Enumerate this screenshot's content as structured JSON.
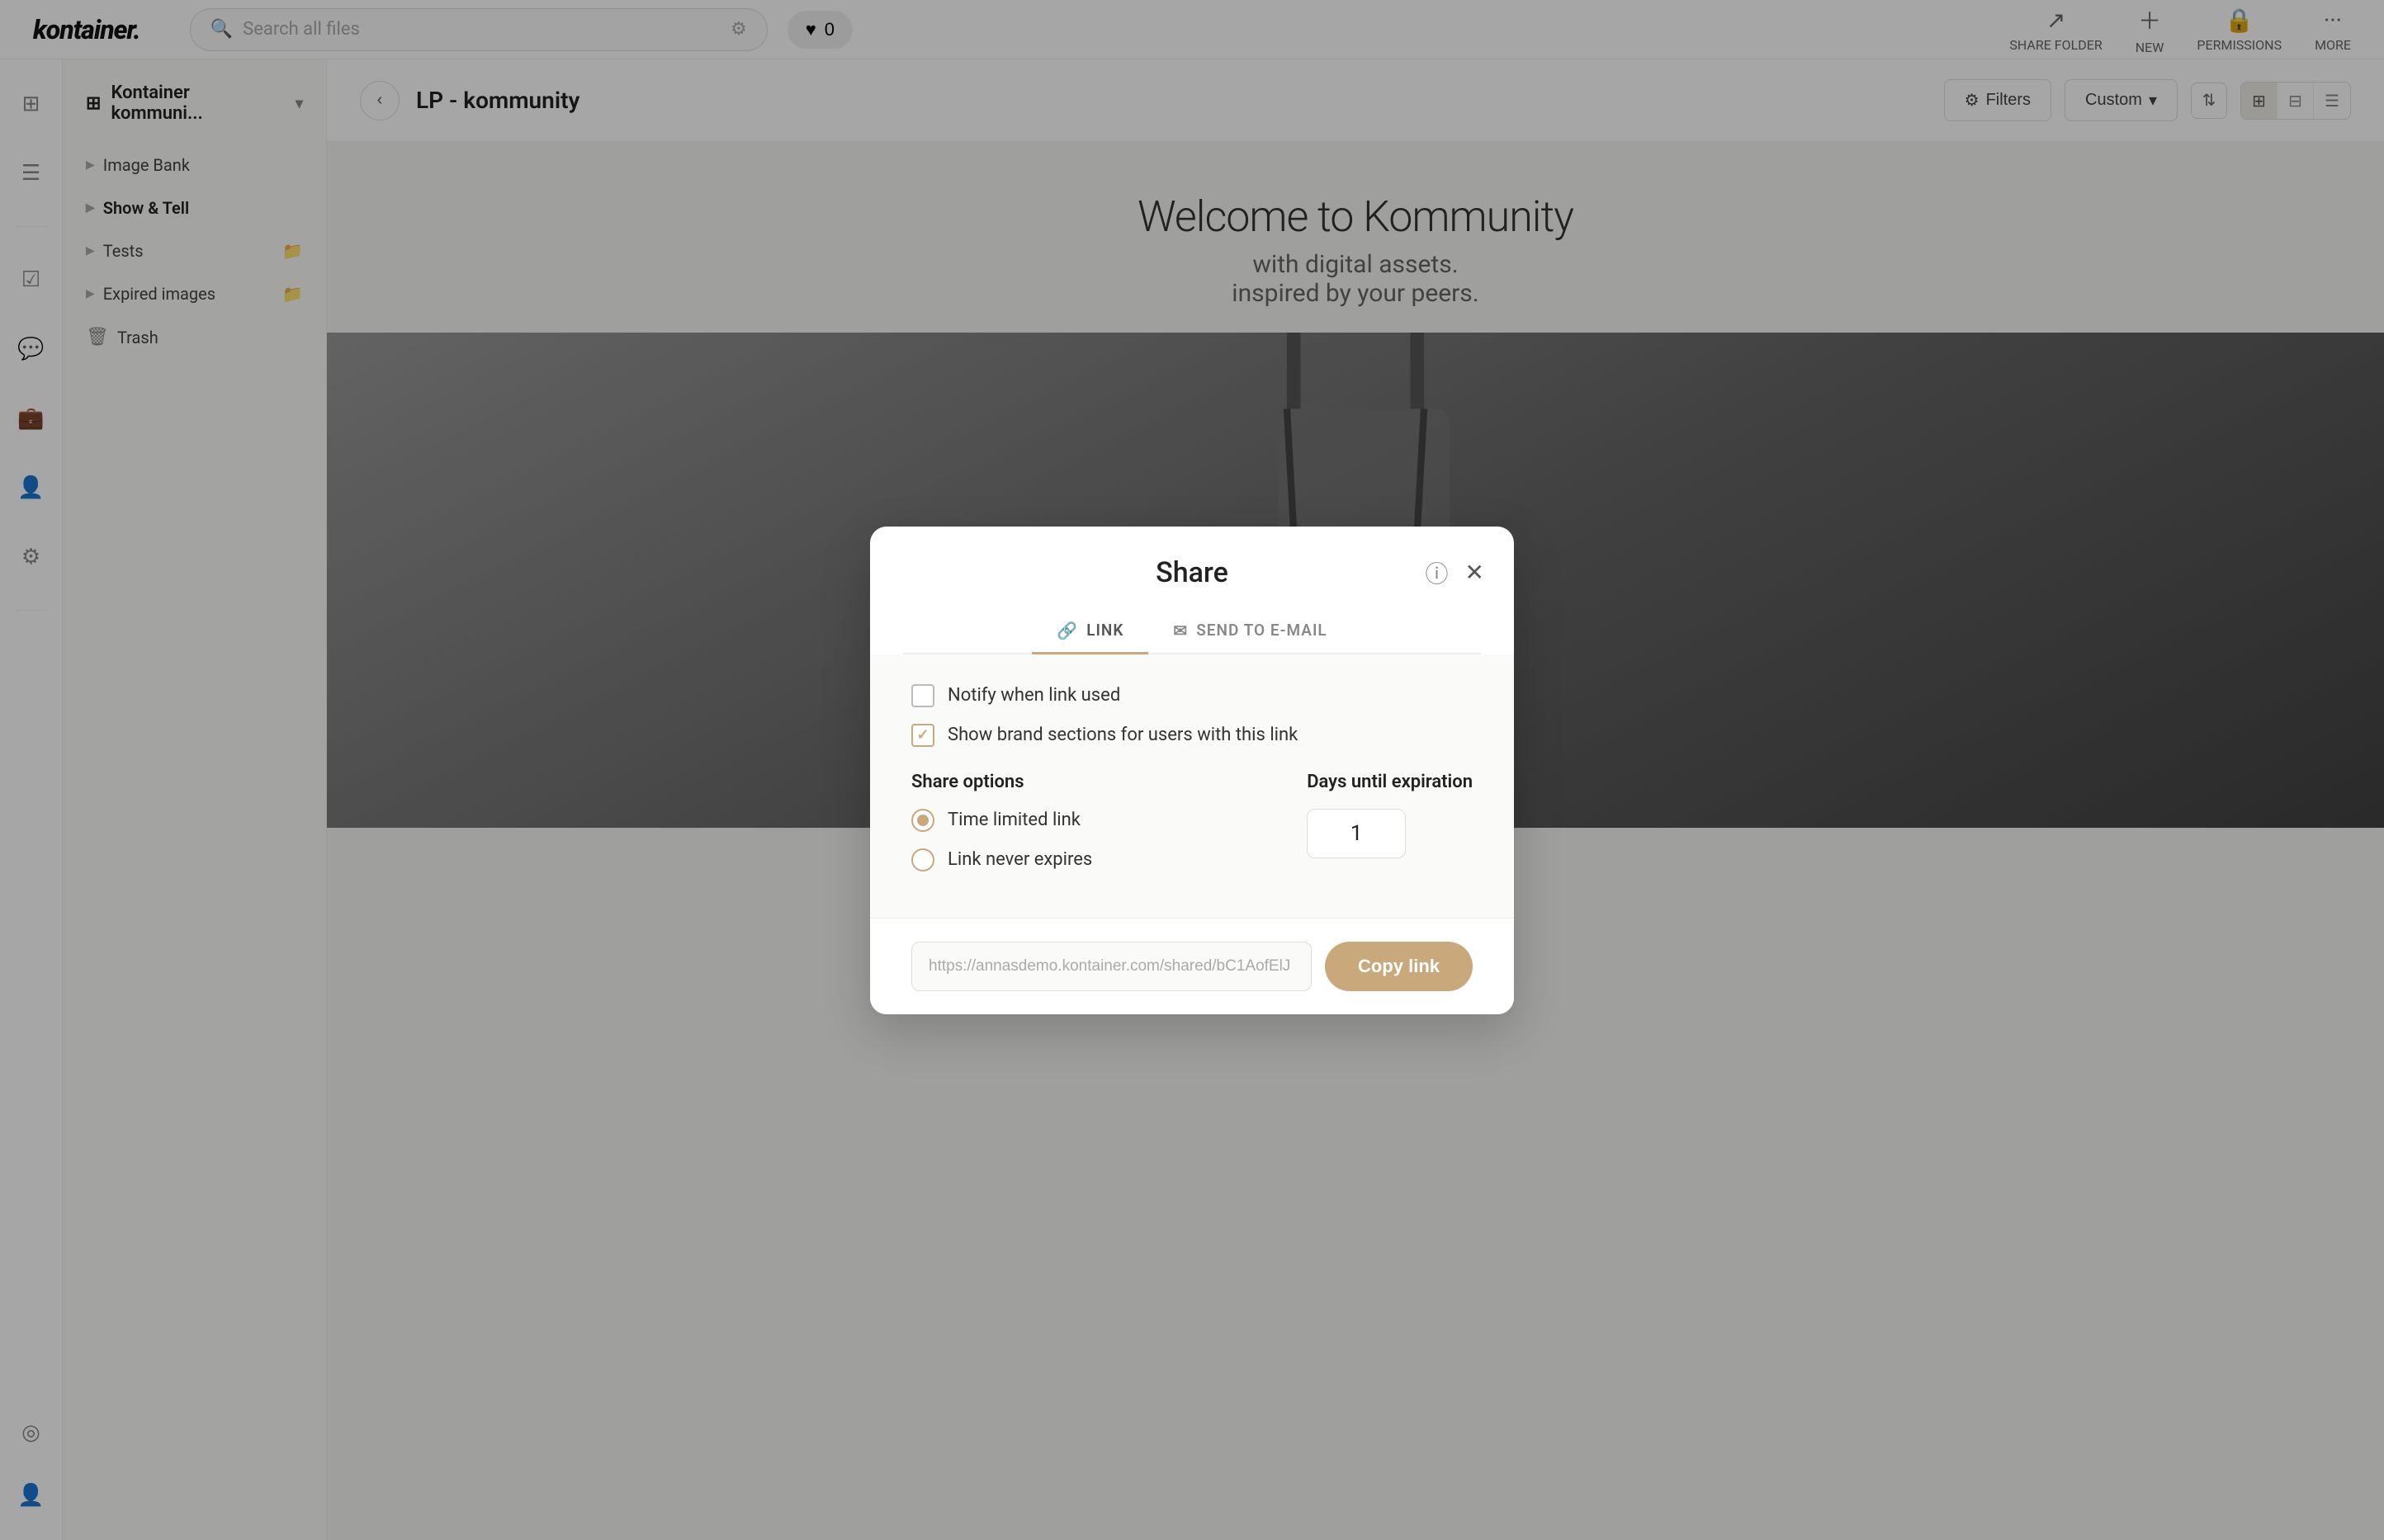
{
  "app": {
    "logo": "kontainer.",
    "topbar": {
      "search_placeholder": "Search all files",
      "favorites_label": "0",
      "share_folder_label": "SHARE FOLDER",
      "new_label": "NEW",
      "permissions_label": "PERMISSIONS",
      "more_label": "MORE"
    }
  },
  "sidebar": {
    "icons": [
      {
        "name": "grid-icon",
        "symbol": "⊞",
        "active": false
      },
      {
        "name": "list-icon",
        "symbol": "☰",
        "active": false
      },
      {
        "name": "check-icon",
        "symbol": "☑",
        "active": false
      },
      {
        "name": "chat-icon",
        "symbol": "💬",
        "active": false
      },
      {
        "name": "briefcase-icon",
        "symbol": "💼",
        "active": false
      },
      {
        "name": "user-icon",
        "symbol": "👤",
        "active": false
      },
      {
        "name": "settings-icon",
        "symbol": "⚙",
        "active": false
      }
    ],
    "bottom_icons": [
      {
        "name": "help-icon",
        "symbol": "◎"
      },
      {
        "name": "profile-icon",
        "symbol": "👤"
      }
    ]
  },
  "nav": {
    "org_name": "Kontainer kommuni...",
    "items": [
      {
        "label": "Image Bank",
        "active": false,
        "has_folder": false
      },
      {
        "label": "Show & Tell",
        "active": true,
        "has_folder": false
      },
      {
        "label": "Tests",
        "active": false,
        "has_folder": true
      },
      {
        "label": "Expired images",
        "active": false,
        "has_folder": true
      }
    ],
    "trash_label": "Trash"
  },
  "main": {
    "breadcrumb": "LP - kommunity",
    "filters_label": "Filters",
    "custom_label": "Custom",
    "hero_title": "Welcome to Kommunity",
    "hero_desc1": "with digital assets.",
    "hero_desc2": "inspired by your peers."
  },
  "modal": {
    "title": "Share",
    "tabs": [
      {
        "id": "link",
        "label": "LINK",
        "icon": "🔗",
        "active": true
      },
      {
        "id": "email",
        "label": "SEND TO E-MAIL",
        "icon": "✉",
        "active": false
      }
    ],
    "notify_label": "Notify when link used",
    "notify_checked": false,
    "brand_label": "Show brand sections for users with this link",
    "brand_checked": true,
    "share_options_title": "Share options",
    "radio_options": [
      {
        "label": "Time limited link",
        "selected": true
      },
      {
        "label": "Link never expires",
        "selected": false
      }
    ],
    "expiry_title": "Days until expiration",
    "expiry_value": "1",
    "link_url": "https://annasdemo.kontainer.com/shared/bC1AofElJ",
    "copy_btn_label": "Copy link"
  }
}
